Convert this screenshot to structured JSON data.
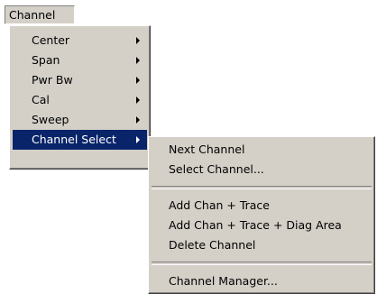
{
  "menubar": {
    "channel_label": "Channel"
  },
  "channel_menu": {
    "items": [
      {
        "label": "Center",
        "has_submenu": true
      },
      {
        "label": "Span",
        "has_submenu": true
      },
      {
        "label": "Pwr Bw",
        "has_submenu": true
      },
      {
        "label": "Cal",
        "has_submenu": true
      },
      {
        "label": "Sweep",
        "has_submenu": true
      },
      {
        "label": "Channel Select",
        "has_submenu": true,
        "selected": true
      }
    ]
  },
  "channel_select_menu": {
    "items": [
      {
        "label": "Next Channel"
      },
      {
        "label": "Select Channel..."
      },
      {
        "label": "Add Chan + Trace"
      },
      {
        "label": "Add Chan + Trace + Diag Area"
      },
      {
        "label": "Delete Channel"
      },
      {
        "label": "Channel Manager..."
      }
    ]
  },
  "colors": {
    "menu_background": "#d4d0c8",
    "highlight": "#0a246a",
    "highlight_text": "#ffffff"
  },
  "icons": {
    "submenu_arrow": "chevron-right-icon"
  }
}
